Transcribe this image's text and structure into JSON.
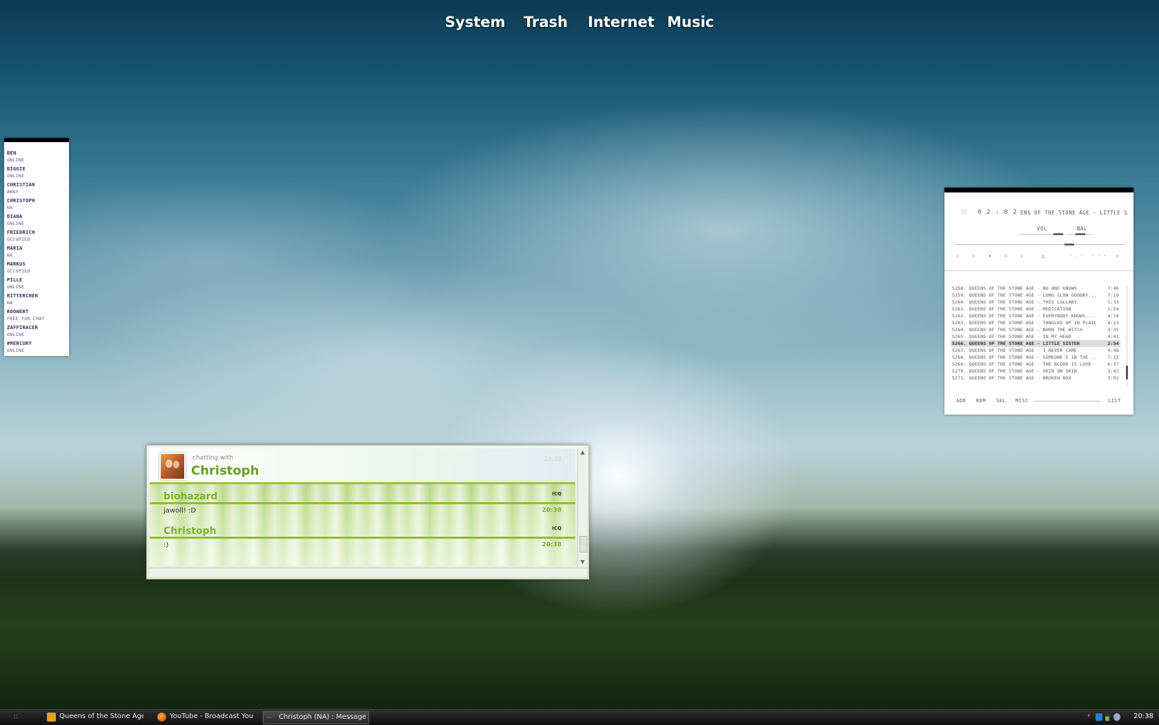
{
  "top_menu": {
    "items": [
      "System",
      "Trash",
      "Internet",
      "Music"
    ]
  },
  "contacts": [
    {
      "name": "Ben",
      "status": "online"
    },
    {
      "name": "Biggie",
      "status": "online"
    },
    {
      "name": "Christian",
      "status": "away"
    },
    {
      "name": "Christoph",
      "status": "NA"
    },
    {
      "name": "Diana",
      "status": "online"
    },
    {
      "name": "Friedrich",
      "status": "occupied"
    },
    {
      "name": "Maria",
      "status": "NA"
    },
    {
      "name": "Markus",
      "status": "occupied"
    },
    {
      "name": "Pille",
      "status": "online"
    },
    {
      "name": "Ritterchen",
      "status": "NA"
    },
    {
      "name": "Roowert",
      "status": "free for chat"
    },
    {
      "name": "Zaffiracer",
      "status": "online"
    },
    {
      "name": "#mercury",
      "status": "online"
    }
  ],
  "player": {
    "time": "0 2 : 0 2",
    "scroll_title": "ENS OF THE STONE AGE - LITTLE S",
    "vol_label": "VOL",
    "bal_label": "BAL",
    "controls": {
      "prev": "‹",
      "play": "›",
      "pause": "⏸",
      "stop": "◻",
      "next": "›",
      "eject": "⌂",
      "shuffle": "· . ·",
      "repeat": "· - ·",
      "min": "▫"
    },
    "playlist": [
      {
        "title": "5258. QUEENS OF THE STONE AGE - NO ONE KNOWS",
        "duration": "7:46"
      },
      {
        "title": "5259. QUEENS OF THE STONE AGE - LONG SLOW GOODBY...",
        "duration": "7:19"
      },
      {
        "title": "5260. QUEENS OF THE STONE AGE - THIS LULLABY",
        "duration": "1:33"
      },
      {
        "title": "5261. QUEENS OF THE STONE AGE - MEDICATION",
        "duration": "1:54"
      },
      {
        "title": "5262. QUEENS OF THE STONE AGE - EVERYBODY KNOWS...",
        "duration": "4:14"
      },
      {
        "title": "5263. QUEENS OF THE STONE AGE - TANGLED UP IN PLAID",
        "duration": "4:13"
      },
      {
        "title": "5264. QUEENS OF THE STONE AGE - BURN THE WITCH",
        "duration": "3:35"
      },
      {
        "title": "5265. QUEENS OF THE STONE AGE - IN MY HEAD",
        "duration": "4:01"
      },
      {
        "title": "5266. QUEENS OF THE STONE AGE - LITTLE SISTER",
        "duration": "2:54"
      },
      {
        "title": "5267. QUEENS OF THE STONE AGE - I NEVER CAME",
        "duration": "4:48"
      },
      {
        "title": "5268. QUEENS OF THE STONE AGE - SOMEONE'S IN THE ...",
        "duration": "7:15"
      },
      {
        "title": "5269. QUEENS OF THE STONE AGE - THE BLOOD IS LOVE",
        "duration": "6:37"
      },
      {
        "title": "5270. QUEENS OF THE STONE AGE - SKIN ON SKIN",
        "duration": "3:42"
      },
      {
        "title": "5271. QUEENS OF THE STONE AGE - BROKEN BOX",
        "duration": "3:02"
      }
    ],
    "active_index": 8,
    "buttons": [
      "ADD",
      "REM",
      "SEL",
      "MISC"
    ],
    "list_button": "LIST"
  },
  "chat": {
    "subtitle": "chatting with",
    "contact": "Christoph",
    "header_time": "20:38",
    "messages": [
      {
        "sender": "biohazard",
        "protocol": "ICQ",
        "text": "jawoll! :D",
        "time": "20:38"
      },
      {
        "sender": "Christoph",
        "protocol": "ICQ",
        "text": ":)",
        "time": "20:38"
      }
    ]
  },
  "taskbar": {
    "tasks": [
      {
        "label": "Queens of the Stone Age ...",
        "icon": "winamp-icon",
        "color": "#e8a020"
      },
      {
        "label": "YouTube - Broadcast You...",
        "icon": "firefox-icon",
        "color": "#e06a1a"
      },
      {
        "label": "Christoph (NA) : Message...",
        "icon": "chat-icon",
        "color": "#444444"
      }
    ],
    "active_task": 2,
    "tray_arrow": "‹",
    "clock": "20:38"
  },
  "colors": {
    "accent_green": "#7db02a",
    "contact_name": "#3a1e54"
  }
}
